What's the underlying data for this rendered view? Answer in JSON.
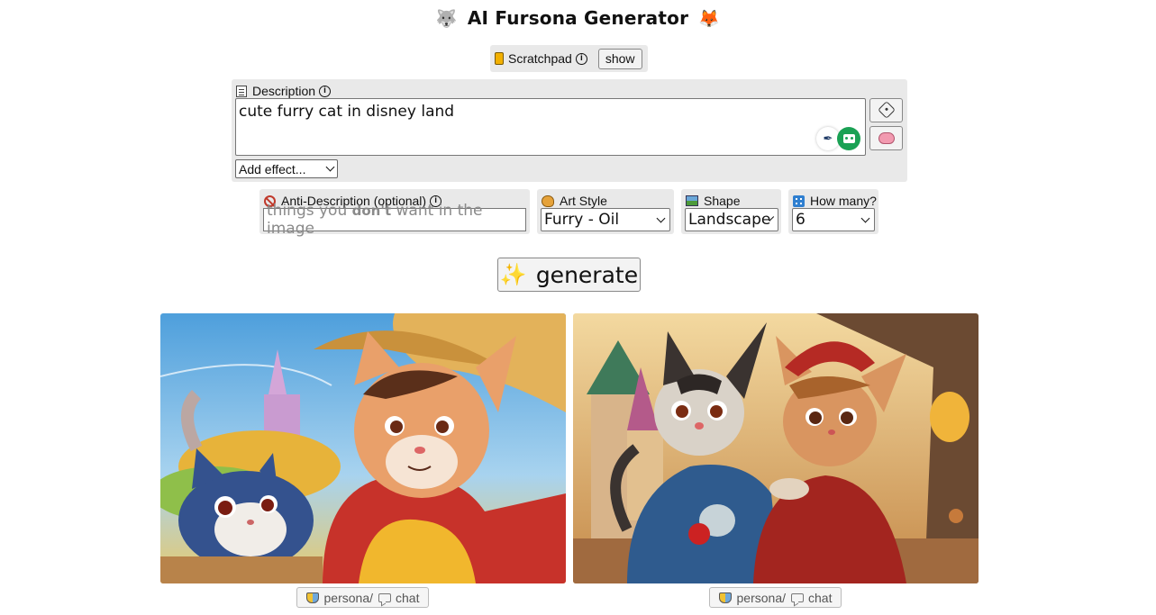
{
  "header": {
    "title": "AI Fursona Generator",
    "left_emoji": "🐺",
    "right_emoji": "🦊"
  },
  "scratchpad": {
    "label": "Scratchpad",
    "info_icon": "info-icon",
    "show_button": "show"
  },
  "description": {
    "label": "Description",
    "value": "cute furry cat in disney land",
    "effect_select": "Add effect..."
  },
  "anti_description": {
    "label": "Anti-Description (optional)",
    "placeholder_pre": "things you ",
    "placeholder_bold": "don't",
    "placeholder_post": " want in the image"
  },
  "art_style": {
    "label": "Art Style",
    "selected": "Furry - Oil"
  },
  "shape": {
    "label": "Shape",
    "selected": "Landscape"
  },
  "how_many": {
    "label": "How many?",
    "selected": "6"
  },
  "generate": {
    "label": "generate"
  },
  "results": [
    {
      "persona": "persona",
      "separator": " / ",
      "chat": "chat"
    },
    {
      "persona": "persona",
      "separator": " / ",
      "chat": "chat"
    }
  ]
}
